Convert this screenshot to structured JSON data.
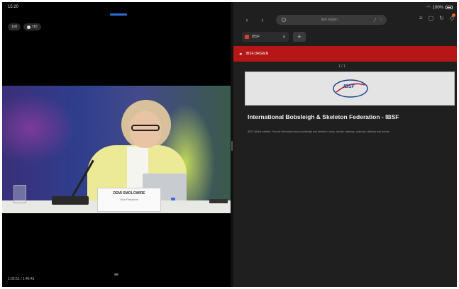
{
  "status_bar": {
    "time": "15:20",
    "battery_text": "100%"
  },
  "video": {
    "controls": [
      "100",
      "HD"
    ],
    "nameplate_name": "DEMI SMOLOWIRE",
    "nameplate_role": "Vice-President",
    "subtitle": "1:02:51 / 1:46:41"
  },
  "browser": {
    "url": "ibsf.org/en",
    "tab_title": "IBSF",
    "banner_title": "IBSF.ORG/EN",
    "pager": "1 / 1",
    "logo_text": "IBSF",
    "heading": "International Bobsleigh & Skeleton Federation - IBSF",
    "description": "IBSF official website. Find all information about bobsleigh and skeleton: news, results, rankings, calendar, athletes and events."
  }
}
